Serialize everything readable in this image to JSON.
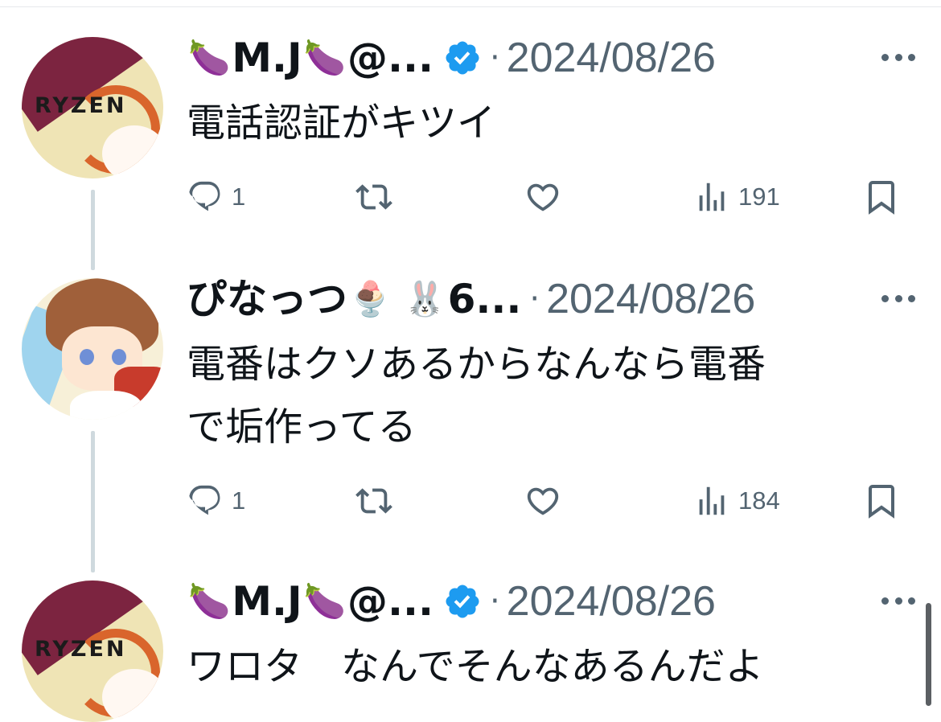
{
  "tweets": [
    {
      "name": "M.J",
      "name_emoji_left": "🍆",
      "name_emoji_right": "🍆",
      "handle": "@...",
      "verified": true,
      "separator": "·",
      "date": "2024/08/26",
      "text_lines": [
        "電話認証がキツイ"
      ],
      "avatar_text": "RYZEN",
      "replies": "1",
      "reposts": "",
      "likes": "",
      "views": "191",
      "icons": [
        "reply-icon",
        "repost-icon",
        "like-icon",
        "views-icon",
        "bookmark-icon"
      ]
    },
    {
      "name": "ぴなっつ",
      "name_emoji_left": "🍨",
      "name_emoji_right": "🐰",
      "handle": "6...",
      "verified": false,
      "separator": "·",
      "date": "2024/08/26",
      "text_lines": [
        "電番はクソあるからなんなら電番",
        "で垢作ってる"
      ],
      "replies": "1",
      "reposts": "",
      "likes": "",
      "views": "184",
      "icons": [
        "reply-icon",
        "repost-icon",
        "like-icon",
        "views-icon",
        "bookmark-icon"
      ]
    },
    {
      "name": "M.J",
      "name_emoji_left": "🍆",
      "name_emoji_right": "🍆",
      "handle": "@...",
      "verified": true,
      "separator": "·",
      "date": "2024/08/26",
      "text_lines": [
        "ワロタ　なんでそんなあるんだよ"
      ],
      "avatar_text": "RYZEN"
    }
  ],
  "colors": {
    "text_primary": "#0f1419",
    "text_secondary": "#536471",
    "verified_blue": "#1d9bf0",
    "thread_line": "#cfd9de"
  }
}
